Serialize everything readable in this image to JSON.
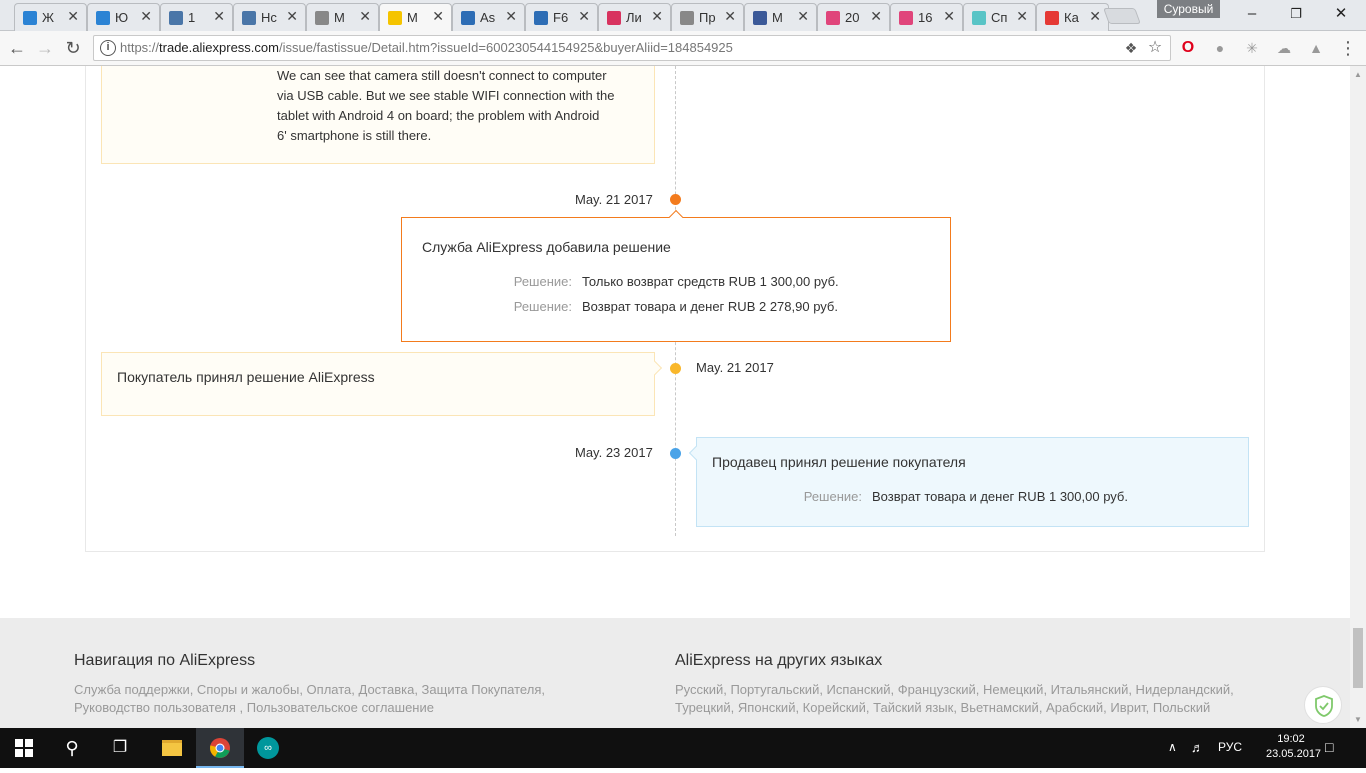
{
  "browser": {
    "tabs": [
      {
        "label": "Ж",
        "icon": "plane-icon",
        "color": "#2b83d4"
      },
      {
        "label": "Ю",
        "icon": "plane-icon",
        "color": "#2b83d4"
      },
      {
        "label": "1",
        "icon": "one-icon",
        "color": "#4a76a8"
      },
      {
        "label": "Нс",
        "icon": "vk-icon",
        "color": "#4a76a8"
      },
      {
        "label": "М",
        "icon": "page-icon",
        "color": "#888888"
      },
      {
        "label": "М",
        "icon": "aliexpress-icon",
        "color": "#f5c400",
        "active": true
      },
      {
        "label": "As",
        "icon": "ali-z-icon",
        "color": "#2d6db5"
      },
      {
        "label": "F6",
        "icon": "ali-z-icon",
        "color": "#2d6db5"
      },
      {
        "label": "Ли",
        "icon": "d-icon",
        "color": "#d8335f"
      },
      {
        "label": "Пр",
        "icon": "page-icon",
        "color": "#888888"
      },
      {
        "label": "М",
        "icon": "facebook-icon",
        "color": "#3b5998"
      },
      {
        "label": "20",
        "icon": "donut-icon",
        "color": "#e0457b"
      },
      {
        "label": "16",
        "icon": "donut-icon",
        "color": "#e0457b"
      },
      {
        "label": "Сп",
        "icon": "pin-icon",
        "color": "#58c4c6"
      },
      {
        "label": "Ка",
        "icon": "map-pin-icon",
        "color": "#e53935"
      }
    ],
    "profile_name": "Суровый",
    "url_prefix": "https://",
    "url_domain": "trade.aliexpress.com",
    "url_path": "/issue/fastissue/Detail.htm?issueId=600230544154925&buyerAliid=184854925"
  },
  "timeline": {
    "top_card_text_line1": "We can see that camera still doesn't connect to computer",
    "top_card_text_line2": "via USB cable. But we see stable WIFI connection with the",
    "top_card_text_line3": "tablet with Android 4 on board; the problem with Android",
    "top_card_text_line4": "6' smartphone is still there.",
    "event1": {
      "date": "May. 21 2017",
      "title": "Служба AliExpress добавила решение",
      "rows": [
        {
          "key": "Решение:",
          "value": "Только возврат средств RUB 1 300,00 руб."
        },
        {
          "key": "Решение:",
          "value": "Возврат товара и денег RUB 2 278,90 руб."
        }
      ]
    },
    "event2": {
      "date": "May. 21 2017",
      "title": "Покупатель принял решение AliExpress"
    },
    "event3": {
      "date": "May. 23 2017",
      "title": "Продавец принял решение покупателя",
      "rows": [
        {
          "key": "Решение:",
          "value": "Возврат товара и денег RUB 1 300,00 руб."
        }
      ]
    },
    "colors": {
      "orange": "#f37b1d",
      "yellow": "#f9b72b",
      "blue": "#4aa3e8"
    }
  },
  "footer": {
    "nav_title": "Навигация по AliExpress",
    "nav_line1": "Служба поддержки, Споры и жалобы, Оплата, Доставка, Защита Покупателя,",
    "nav_line2": "Руководство пользователя , Пользовательское соглашение",
    "lang_title": "AliExpress на других языках",
    "lang_line1": "Русский, Португальский, Испанский, Французский, Немецкий, Итальянский, Нидерландский,",
    "lang_line2": "Турецкий, Японский, Корейский, Тайский язык, Вьетнамский, Арабский, Иврит, Польский"
  },
  "taskbar": {
    "language": "РУС",
    "time": "19:02",
    "date": "23.05.2017"
  }
}
